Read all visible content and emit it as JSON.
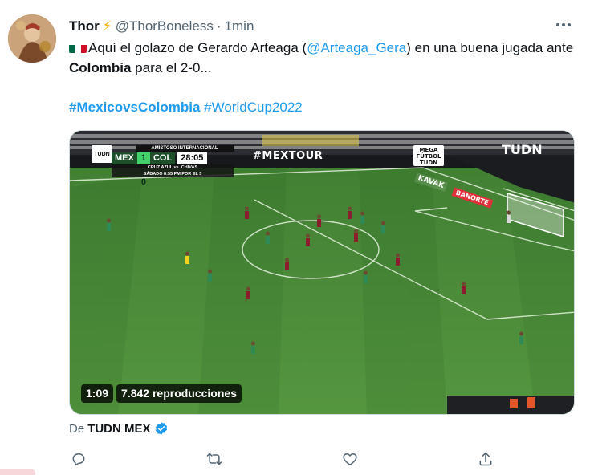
{
  "tweet": {
    "author": {
      "display_name": "Thor",
      "emoji_icon": "lightning-bolt",
      "handle": "@ThorBoneless",
      "separator": "·",
      "time": "1min"
    },
    "more_icon": "more-horizontal-icon",
    "text": {
      "flag_icon": "mexico-flag",
      "part1": "Aquí el golazo de Gerardo Arteaga (",
      "mention": "@Arteaga_Gera",
      "part2": ") en una buena jugada ante ",
      "bold": "Colombia",
      "part3": " para el 2-0..."
    },
    "hashtags": {
      "tag1": "#MexicovsColombia",
      "tag2": "#WorldCup2022"
    },
    "media": {
      "scoreboard": {
        "network_logo": "TUDN",
        "competition": "AMISTOSO INTERNACIONAL",
        "home": "MEX",
        "score": "1 - 0",
        "away": "COL",
        "clock": "28:05",
        "promo_line1": "CRUZ AZUL vs. CHIVAS",
        "promo_line2": "SÁBADO 8:55 PM POR EL 5"
      },
      "boards": {
        "mextour": "#MEXTOUR",
        "mega": "MEGA FÚTBOL TUDN",
        "tudn": "TUDN",
        "kavak": "KAVAK",
        "banorte": "BANORTE"
      },
      "duration": "1:09",
      "views": "7.842 reproducciones",
      "colors": {
        "pitch": "#4c8a3a",
        "home_kit": "#2e8b57",
        "away_kit": "#8b1e2e"
      }
    },
    "source": {
      "prefix": "De",
      "name": "TUDN MEX",
      "verified_icon": "verified-badge-icon"
    },
    "actions": {
      "reply": "reply-icon",
      "retweet": "retweet-icon",
      "like": "like-icon",
      "share": "share-icon"
    },
    "colors": {
      "link": "#1d9bf0",
      "secondary": "#536471",
      "primary": "#0f1419"
    }
  }
}
